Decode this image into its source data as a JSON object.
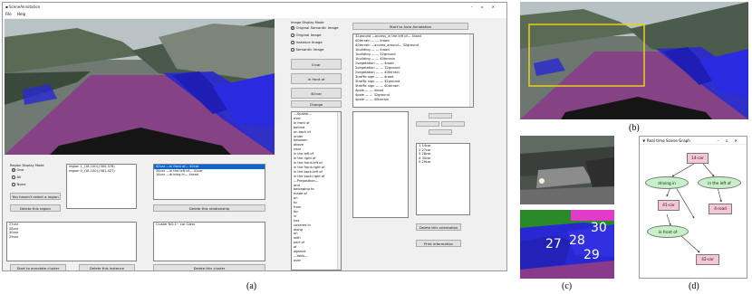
{
  "window": {
    "title": "SceneAnnotation",
    "menu": [
      "File",
      "Help"
    ],
    "controls": [
      "–",
      "▫",
      "✕"
    ]
  },
  "image_display": {
    "title": "Image Display Mode",
    "options": [
      "Original Semantic Image",
      "Original Image",
      "Instance Image",
      "Semantic Image"
    ],
    "selected": 0
  },
  "relation_buttons": [
    "0:car",
    "in front of",
    "40:car",
    "Change"
  ],
  "auto_annotation_button": "Start to Auto Annotation",
  "triplets": [
    "32ground  —access_in the left of—  4road",
    "40terrain  —  —  4road",
    "40terrain  —access_around—  32ground",
    "1building  —  —  4road",
    "1building  —  —  32ground",
    "1building  —  —  40terrain",
    "2vegetation  —  —  4road",
    "2vegetation  —  —  32ground",
    "2vegetation  —  —  40terrain",
    "3traffic sign  —  —  4road",
    "3traffic sign  —  —  32ground",
    "3traffic sign  —  —  40terrain",
    "4pole  —  —  4road",
    "4pole  —  —  32ground",
    "4pole  —  —  40terrain"
  ],
  "predicates": [
    "---Spatial---",
    "over",
    "in front of",
    "behind",
    "on back of",
    "under",
    "between",
    "above",
    "near",
    "in the left of",
    "in the right of",
    "in the front-left of",
    "in the front-right of",
    "in the back-left of",
    "in the back-right of",
    "---Preposition---",
    "and",
    "belonging to",
    "made of",
    "on",
    "to",
    "from",
    "for",
    "in",
    "has",
    "covered in",
    "along",
    "on",
    "with",
    "part of",
    "of",
    "against",
    "---Verb---",
    "over"
  ],
  "region_display": {
    "title": "Region Display Mode",
    "options": [
      "One",
      "All",
      "None"
    ],
    "selected": 0
  },
  "regions": [
    "region 1_(18,100),(300,378)",
    "region 0_(18,100),(581,427)"
  ],
  "no_region_button": "You haven't select a region",
  "delete_region_button": "Delete this region",
  "relationships": [
    "42car  —in front of—  40car",
    "34car  —in the left of—  41car",
    "14car  —driving in—  4road"
  ],
  "delete_relationship_button": "Delete this relationship",
  "orientation_list": [
    "14car",
    "27car",
    "28car",
    "30car",
    "29car"
  ],
  "delete_orientation_button": "Delete this orientation",
  "print_info_button": "Print information",
  "instances": [
    "27car",
    "28car",
    "30car",
    "29car"
  ],
  "cluster_label": "Cluster NO.1~ car Class",
  "start_cluster_button": "Start to annotate cluster",
  "delete_instance_button": "Delete this instance",
  "delete_cluster_button": "Delete this cluster",
  "instance_labels": [
    "27",
    "28",
    "30",
    "29"
  ],
  "graph": {
    "title": "Real time Scene Graph",
    "nodes": [
      "14-car",
      "driving in",
      "in the left of",
      "41-car",
      "4-road",
      "in front of",
      "42-car"
    ]
  },
  "captions": [
    "(a)",
    "(b)",
    "(c)",
    "(d)"
  ],
  "colors": {
    "car_overlay": "#2828d2",
    "road_overlay": "#8a3a8a",
    "highlight_box": "#e8d21a",
    "node_rect": "#f4c6d6",
    "node_ellipse": "#c8f0c8"
  }
}
